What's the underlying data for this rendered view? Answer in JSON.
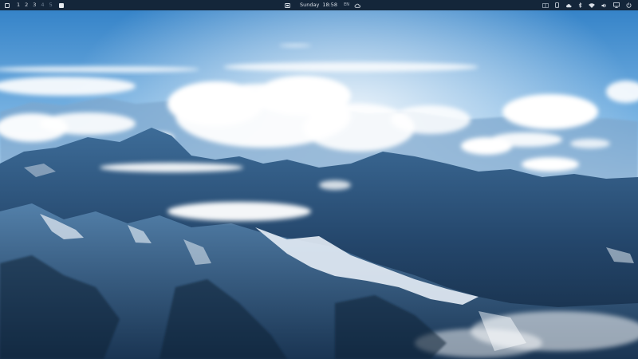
{
  "topbar": {
    "workspaces": [
      {
        "label": "1",
        "dim": false
      },
      {
        "label": "2",
        "dim": false
      },
      {
        "label": "3",
        "dim": false
      },
      {
        "label": "4",
        "dim": true
      },
      {
        "label": "5",
        "dim": true
      }
    ],
    "clock": {
      "day": "Sunday",
      "time": "18:58"
    },
    "language": "EN",
    "icons": {
      "left": [
        "app-launcher-icon",
        "active-workspace-indicator-icon"
      ],
      "center": [
        "screen-record-icon",
        "weather-cloud-icon"
      ],
      "right": [
        "window-layout-icon",
        "phone-icon",
        "cloud-sync-icon",
        "bluetooth-icon",
        "wifi-icon",
        "volume-icon",
        "display-icon",
        "power-icon"
      ]
    }
  },
  "colors": {
    "bar_background": "#14263a",
    "bar_text": "#d8dee6",
    "sky_top": "#2f7fc6",
    "sky_horizon": "#d9ecfa",
    "mountain_dark": "#1a3552",
    "snow": "#e6eef6"
  }
}
